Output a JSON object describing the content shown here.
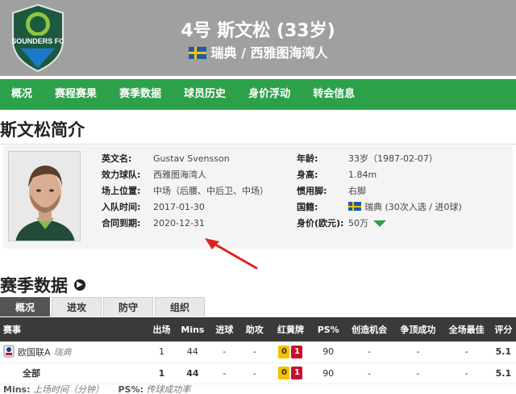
{
  "header": {
    "logo_text": "SOUNDERS FC",
    "title": "4号 斯文松 (33岁)",
    "subtitle": "瑞典 / 西雅图海湾人"
  },
  "nav": [
    "概况",
    "赛程赛果",
    "赛季数据",
    "球员历史",
    "身价浮动",
    "转会信息"
  ],
  "intro": {
    "title": "斯文松简介",
    "left": [
      {
        "label": "英文名:",
        "value": "Gustav Svensson"
      },
      {
        "label": "效力球队:",
        "value": "西雅图海湾人"
      },
      {
        "label": "场上位置:",
        "value": "中场（后腰、中后卫、中场）"
      },
      {
        "label": "入队时间:",
        "value": "2017-01-30"
      },
      {
        "label": "合同到期:",
        "value": "2020-12-31"
      }
    ],
    "right": [
      {
        "label": "年龄:",
        "value": "33岁（1987-02-07）"
      },
      {
        "label": "身高:",
        "value": "1.84m"
      },
      {
        "label": "惯用脚:",
        "value": "右脚"
      },
      {
        "label": "国籍:",
        "value": "瑞典 (30次入选 / 进0球)"
      },
      {
        "label": "身价(欧元):",
        "value": "50万"
      }
    ]
  },
  "season": {
    "title": "赛季数据",
    "tabs": [
      "概况",
      "进攻",
      "防守",
      "组织"
    ],
    "columns": [
      "赛事",
      "出场",
      "Mins",
      "进球",
      "助攻",
      "红黄牌",
      "PS%",
      "创造机会",
      "争顶成功",
      "全场最佳",
      "评分"
    ],
    "rows": [
      {
        "competition": "欧国联A",
        "team": "瑞典",
        "apps": "1",
        "mins": "44",
        "goals": "-",
        "assists": "-",
        "yellow": "0",
        "red": "1",
        "ps": "90",
        "chances": "-",
        "aerial": "-",
        "motm": "-",
        "rating": "5.1"
      },
      {
        "competition": "全部",
        "team": "",
        "apps": "1",
        "mins": "44",
        "goals": "-",
        "assists": "-",
        "yellow": "0",
        "red": "1",
        "ps": "90",
        "chances": "-",
        "aerial": "-",
        "motm": "-",
        "rating": "5.1"
      }
    ],
    "footnote_mins_label": "Mins:",
    "footnote_mins": "上场时间（分钟）",
    "footnote_ps_label": "PS%:",
    "footnote_ps": "传球成功率"
  },
  "colors": {
    "nav_green": "#2da14a",
    "header_gray": "#a0a0a0",
    "rating_orange": "#e8772e"
  }
}
